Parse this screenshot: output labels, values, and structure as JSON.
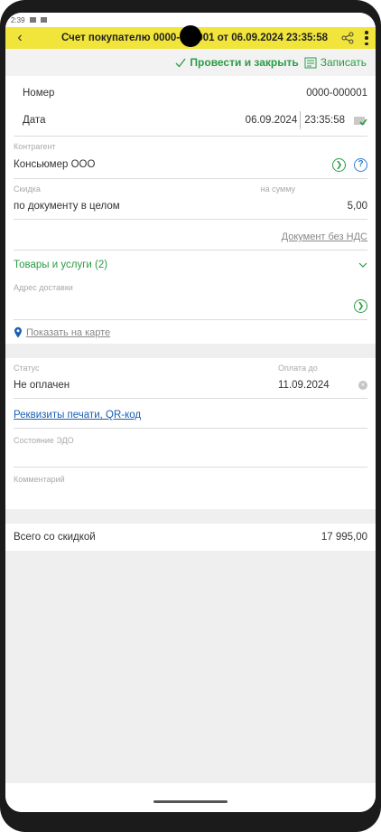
{
  "status_bar": {
    "time": "2:39"
  },
  "header": {
    "back_icon": "chevron-left-icon",
    "title": "Счет покупателю 0000-000001 от 06.09.2024 23:35:58",
    "share_icon": "share-icon",
    "more_icon": "more-vertical-icon",
    "bg_color": "#f1e43a"
  },
  "actions": {
    "post_close_label": "Провести и закрыть",
    "save_label": "Записать",
    "accent_color": "#2a9d45"
  },
  "document": {
    "number_label": "Номер",
    "number_value": "0000-000001",
    "date_label": "Дата",
    "date_value": "06.09.2024",
    "time_value": "23:35:58"
  },
  "counterparty": {
    "label": "Контрагент",
    "value": "Консьюмер ООО"
  },
  "discount": {
    "label": "Скидка",
    "amount_label": "на сумму",
    "value": "по документу в целом",
    "amount_value": "5,00",
    "no_vat_link": "Документ без НДС"
  },
  "goods": {
    "label": "Товары и услуги (2)"
  },
  "delivery": {
    "label": "Адрес доставки",
    "value": "",
    "map_link": "Показать на карте"
  },
  "payment": {
    "status_label": "Статус",
    "status_value": "Не оплачен",
    "due_label": "Оплата до",
    "due_value": "11.09.2024",
    "print_link": "Реквизиты печати, QR-код",
    "edo_label": "Состояние ЭДО",
    "comment_label": "Комментарий"
  },
  "total": {
    "label": "Всего со скидкой",
    "value": "17 995,00"
  }
}
